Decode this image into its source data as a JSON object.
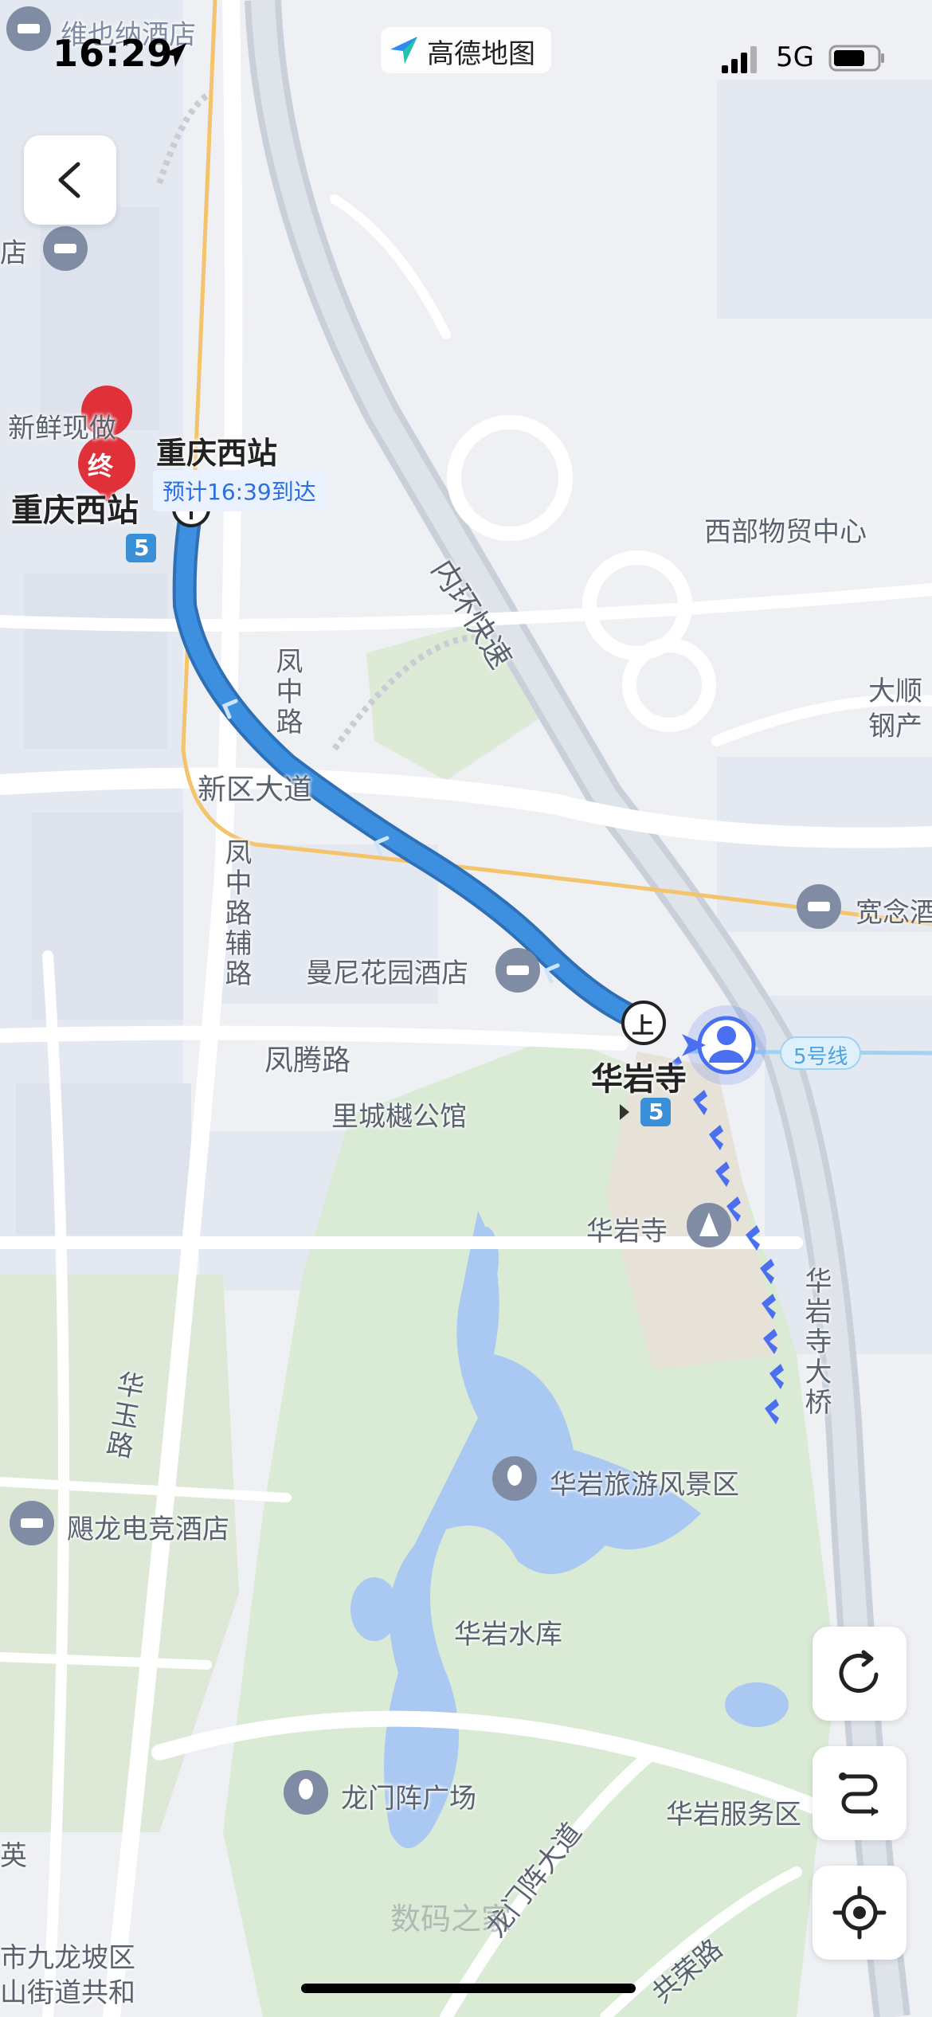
{
  "status_bar": {
    "time": "16:29",
    "app_name": "高德地图",
    "network": "5G"
  },
  "map": {
    "destination_name": "重庆西站",
    "destination_station_label": "重庆西站",
    "destination_marker_text": "终",
    "eta_text": "预计16:39到达",
    "boarding_marker_text": "上",
    "origin_station": "华岩寺",
    "metro_line_number": "5",
    "metro_line_label": "5号线",
    "route_color": "#3d8fe0",
    "walk_color": "#4a6ff0",
    "places": [
      {
        "id": "hotel-top",
        "text": "维也纳酒店"
      },
      {
        "id": "fresh",
        "text": "新鲜现做"
      },
      {
        "id": "store",
        "text": "店"
      },
      {
        "id": "west-trade",
        "text": "西部物贸中心"
      },
      {
        "id": "inner-ring",
        "text": "内环快速"
      },
      {
        "id": "dashun",
        "text": "大顺"
      },
      {
        "id": "gangchan",
        "text": "钢产"
      },
      {
        "id": "fengzhong-road",
        "text": "凤中路"
      },
      {
        "id": "xinqu-avenue",
        "text": "新区大道"
      },
      {
        "id": "fengzhong-aux",
        "text": "凤中路辅路"
      },
      {
        "id": "kuannian",
        "text": "宽念酒"
      },
      {
        "id": "manni-hotel",
        "text": "曼尼花园酒店"
      },
      {
        "id": "fengteng-road",
        "text": "凤腾路"
      },
      {
        "id": "licheng",
        "text": "里城樾公馆"
      },
      {
        "id": "huayan-temple",
        "text": "华岩寺"
      },
      {
        "id": "huayan-bridge",
        "text": "华岩寺大桥"
      },
      {
        "id": "huayu-road",
        "text": "华玉路"
      },
      {
        "id": "huayan-scenic",
        "text": "华岩旅游风景区"
      },
      {
        "id": "julong-hotel",
        "text": "飓龙电竞酒店"
      },
      {
        "id": "huayan-reservoir",
        "text": "华岩水库"
      },
      {
        "id": "longmen-plaza",
        "text": "龙门阵广场"
      },
      {
        "id": "huayan-service",
        "text": "华岩服务区"
      },
      {
        "id": "longmen-avenue",
        "text": "龙门阵大道"
      },
      {
        "id": "gongrong-road",
        "text": "共荣路"
      },
      {
        "id": "ying",
        "text": "英"
      },
      {
        "id": "jiulongpo-1",
        "text": "市九龙坡区"
      },
      {
        "id": "jiulongpo-2",
        "text": "山街道共和"
      }
    ],
    "watermark": "数码之家"
  },
  "controls": {
    "back": "back",
    "refresh": "refresh",
    "route": "route",
    "locate": "locate"
  }
}
